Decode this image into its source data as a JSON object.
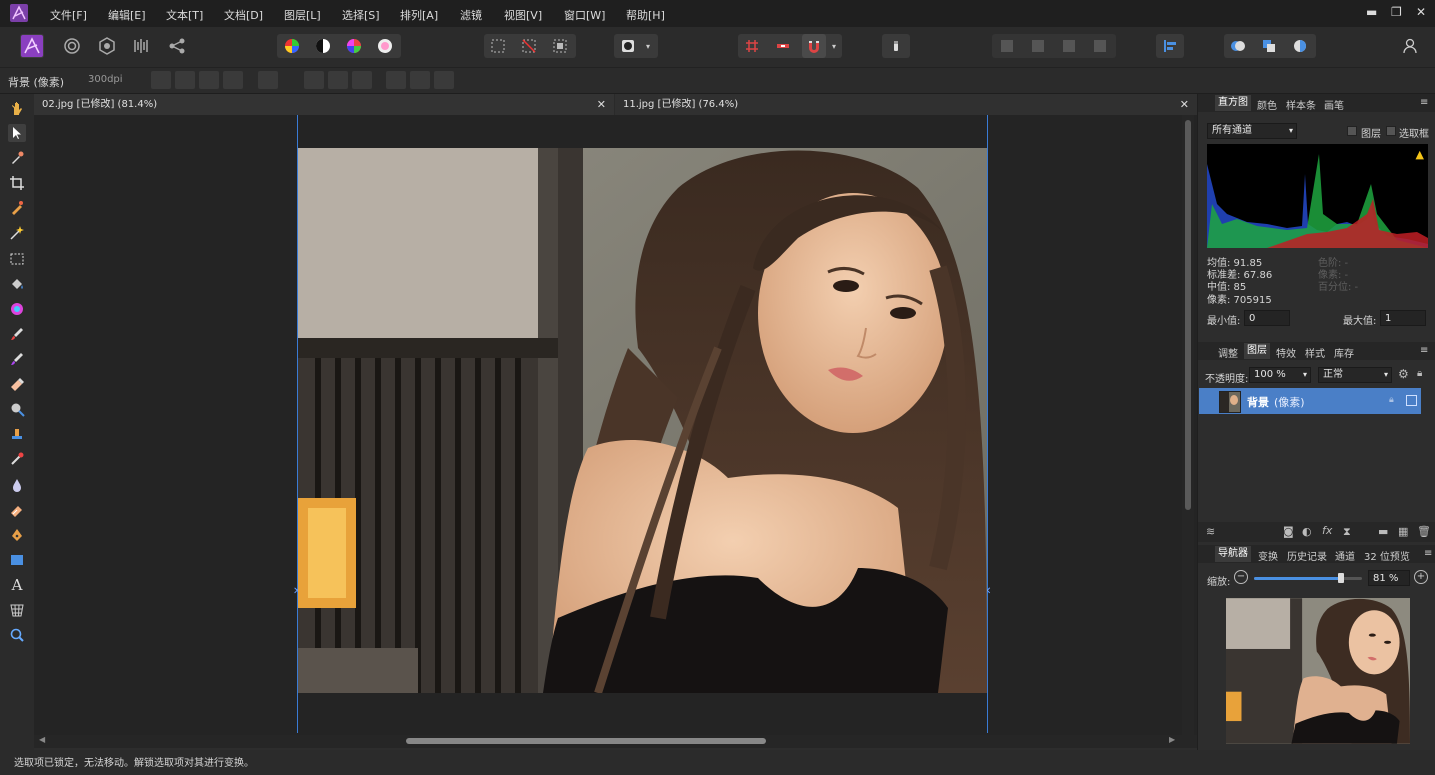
{
  "menu": {
    "items": [
      "文件[F]",
      "编辑[E]",
      "文本[T]",
      "文档[D]",
      "图层[L]",
      "选择[S]",
      "排列[A]",
      "滤镜",
      "视图[V]",
      "窗口[W]",
      "帮助[H]"
    ]
  },
  "window_controls": {
    "minimize": "▬",
    "restore": "❐",
    "close": "✕"
  },
  "context": {
    "layer_label": "背景 (像素)",
    "dpi": "300dpi"
  },
  "tabs": [
    {
      "label": "02.jpg [已修改] (81.4%)",
      "close": "✕"
    },
    {
      "label": "11.jpg [已修改] (76.4%)",
      "close": "✕"
    }
  ],
  "histogram": {
    "tabs": [
      "直方图",
      "颜色",
      "样本条",
      "画笔"
    ],
    "channel": "所有通道",
    "chk_layer": "图层",
    "chk_selection": "选取框",
    "stats_left": [
      "均值: 91.85",
      "标准差: 67.86",
      "中值: 85",
      "像素: 705915"
    ],
    "stats_right": [
      "色阶: -",
      "像素: -",
      "百分位: -"
    ],
    "min_label": "最小值:",
    "min_value": "0",
    "max_label": "最大值:",
    "max_value": "1"
  },
  "layers": {
    "tabs": [
      "调整",
      "图层",
      "特效",
      "样式",
      "库存"
    ],
    "opacity_label": "不透明度:",
    "opacity_value": "100 %",
    "blend": "正常",
    "items": [
      {
        "name": "背景",
        "type": "(像素)"
      }
    ]
  },
  "navigator": {
    "tabs": [
      "导航器",
      "变换",
      "历史记录",
      "通道",
      "32 位预览"
    ],
    "zoom_label": "缩放:",
    "zoom_value": "81 %",
    "zoom_level": 0.81
  },
  "status": {
    "message": "选取项已锁定，无法移动。解锁选取项对其进行变换。"
  },
  "colors": {
    "accent": "#3a7bd5",
    "app_bg": "#2d2d2d",
    "canvas_bg": "#242424",
    "selected_layer": "#4a7fc7"
  }
}
